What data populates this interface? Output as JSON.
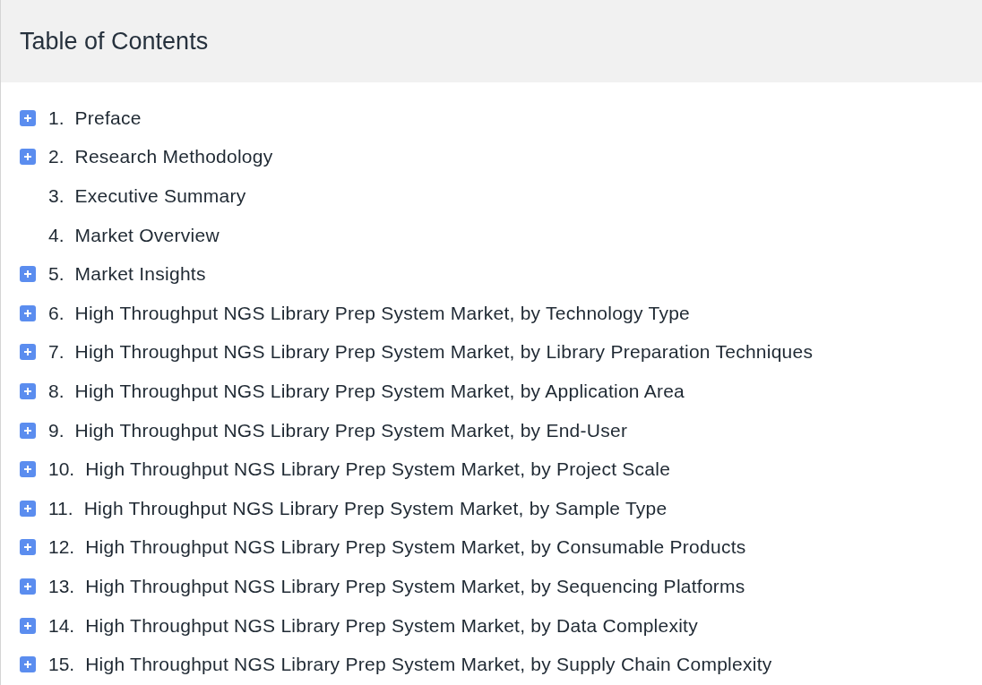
{
  "title": "Table of Contents",
  "items": [
    {
      "number": "1.",
      "label": "Preface",
      "kind": "expandable"
    },
    {
      "number": "2.",
      "label": "Research Methodology",
      "kind": "expandable"
    },
    {
      "number": "3.",
      "label": "Executive Summary",
      "kind": "leaf"
    },
    {
      "number": "4.",
      "label": "Market Overview",
      "kind": "leaf"
    },
    {
      "number": "5.",
      "label": "Market Insights",
      "kind": "expandable"
    },
    {
      "number": "6.",
      "label": "High Throughput NGS Library Prep System Market, by Technology Type",
      "kind": "expandable"
    },
    {
      "number": "7.",
      "label": "High Throughput NGS Library Prep System Market, by Library Preparation Techniques",
      "kind": "expandable"
    },
    {
      "number": "8.",
      "label": "High Throughput NGS Library Prep System Market, by Application Area",
      "kind": "expandable"
    },
    {
      "number": "9.",
      "label": "High Throughput NGS Library Prep System Market, by End-User",
      "kind": "expandable"
    },
    {
      "number": "10.",
      "label": "High Throughput NGS Library Prep System Market, by Project Scale",
      "kind": "expandable"
    },
    {
      "number": "11.",
      "label": "High Throughput NGS Library Prep System Market, by Sample Type",
      "kind": "expandable"
    },
    {
      "number": "12.",
      "label": "High Throughput NGS Library Prep System Market, by Consumable Products",
      "kind": "expandable"
    },
    {
      "number": "13.",
      "label": "High Throughput NGS Library Prep System Market, by Sequencing Platforms",
      "kind": "expandable"
    },
    {
      "number": "14.",
      "label": "High Throughput NGS Library Prep System Market, by Data Complexity",
      "kind": "expandable"
    },
    {
      "number": "15.",
      "label": "High Throughput NGS Library Prep System Market, by Supply Chain Complexity",
      "kind": "expandable"
    }
  ]
}
